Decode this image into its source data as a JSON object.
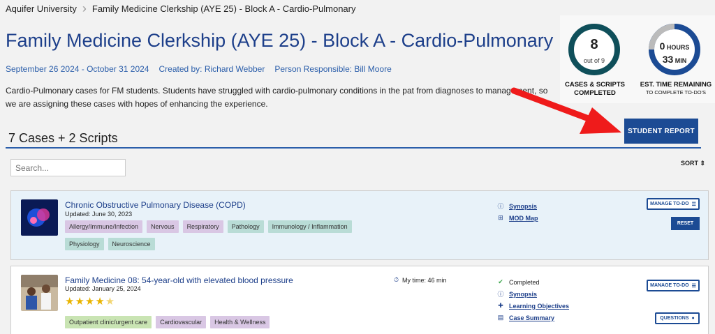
{
  "breadcrumb": {
    "home": "Aquifer University",
    "current": "Family Medicine Clerkship (AYE 25) - Block A - Cardio-Pulmonary"
  },
  "page": {
    "title": "Family Medicine Clerkship (AYE 25) - Block A - Cardio-Pulmonary",
    "dates": "September 26 2024 -  October 31 2024",
    "created_by": "Created by: Richard Webber",
    "person_responsible": "Person Responsible: Bill Moore",
    "description": "Cardio-Pulmonary cases for FM students. Students have struggled with cardio-pulmonary conditions in the pat from diagnoses to management, so we are assigning these cases with hopes of enhancing the experience."
  },
  "stats": {
    "completed_count": "8",
    "completed_total": "out of 9",
    "completed_fraction": 0.89,
    "completed_label": "CASES & SCRIPTS COMPLETED",
    "hours": "0",
    "hours_unit": "HOURS",
    "minutes": "33",
    "minutes_unit": "MIN",
    "time_label": "EST. TIME REMAINING",
    "time_sublabel": "TO COMPLETE TO-DO'S"
  },
  "buttons": {
    "student_report": "STUDENT REPORT",
    "manage_todo": "MANAGE TO-DO",
    "reset": "RESET",
    "questions": "QUESTIONS"
  },
  "list": {
    "count_label": "7 Cases + 2 Scripts",
    "search_placeholder": "Search...",
    "sort_label": "SORT"
  },
  "cases": [
    {
      "title": "Chronic Obstructive Pulmonary Disease (COPD)",
      "updated": "Updated: June 30, 2023",
      "tags": [
        {
          "label": "Allergy/Immune/Infection",
          "color": "purple"
        },
        {
          "label": "Nervous",
          "color": "purple"
        },
        {
          "label": "Respiratory",
          "color": "purple"
        },
        {
          "label": "Pathology",
          "color": "teal"
        },
        {
          "label": "Immunology / Inflammation",
          "color": "teal"
        },
        {
          "label": "Physiology",
          "color": "teal"
        },
        {
          "label": "Neuroscience",
          "color": "teal"
        }
      ],
      "links": [
        "Synopsis",
        "MOD Map"
      ]
    },
    {
      "title": "Family Medicine 08: 54-year-old with elevated blood pressure",
      "updated": "Updated: January 25, 2024",
      "rating": 4.5,
      "my_time": "My time: 46 min",
      "status": "Completed",
      "tags": [
        {
          "label": "Outpatient clinic/urgent care",
          "color": "green"
        },
        {
          "label": "Cardiovascular",
          "color": "purple"
        },
        {
          "label": "Health & Wellness",
          "color": "purple"
        }
      ],
      "links": [
        "Synopsis",
        "Learning Objectives",
        "Case Summary"
      ]
    }
  ]
}
